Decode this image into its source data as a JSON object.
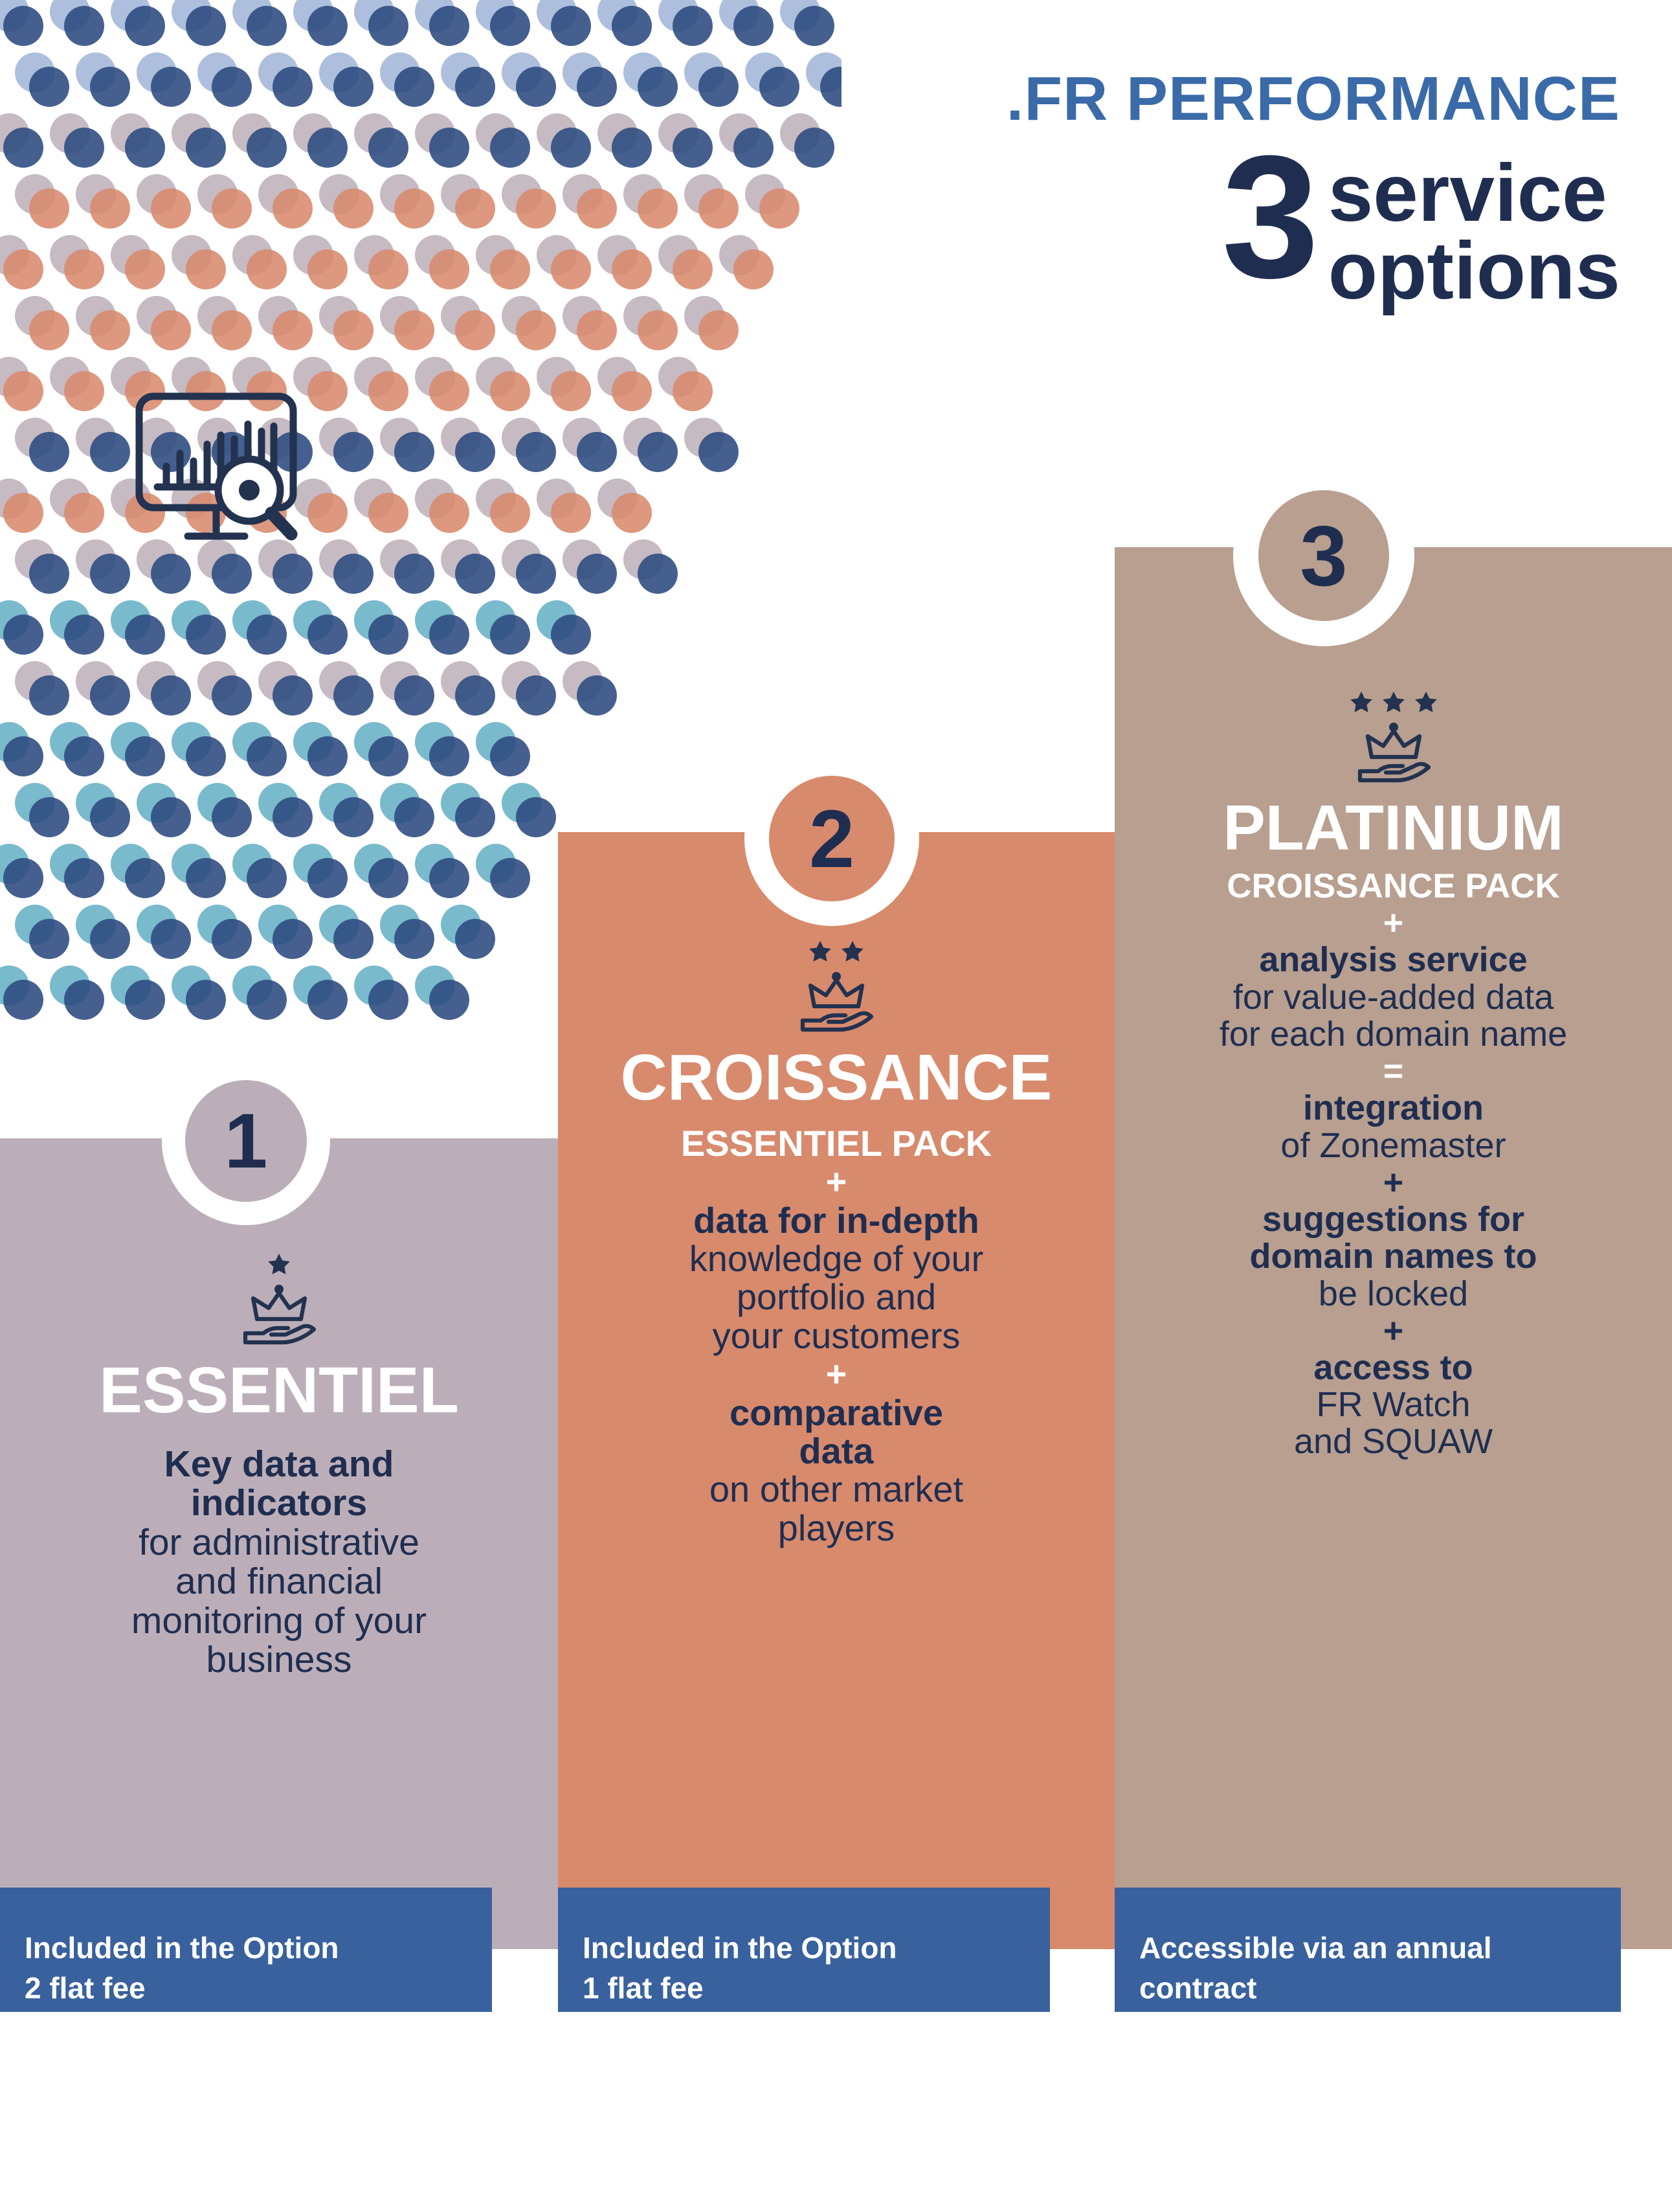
{
  "header": {
    "brand": ".FR PERFORMANCE",
    "count": "3",
    "word_1": "service",
    "word_2": "options"
  },
  "colors": {
    "brand_blue": "#3a6aa8",
    "navy": "#1f2e50",
    "mauve": "#bcaeb8",
    "orange": "#d88a6d",
    "tan": "#b89f90",
    "footer_blue": "#38619e",
    "white": "#ffffff",
    "dot_light_blue": "#9fb4d6",
    "dot_dark_blue": "#2b4a80",
    "dot_mid_blue": "#3a6aa8",
    "dot_teal": "#63aec4",
    "dot_mauve": "#bcaeb8",
    "dot_orange": "#d88a6d"
  },
  "columns": [
    {
      "number": "1",
      "name": "ESSENTIEL",
      "stars": 1,
      "body_lines": [
        {
          "text": "Key data and",
          "bold": true
        },
        {
          "text": "indicators",
          "bold": true
        },
        {
          "text": "for administrative",
          "bold": false
        },
        {
          "text": "and financial",
          "bold": false
        },
        {
          "text": "monitoring of your",
          "bold": false
        },
        {
          "text": "business",
          "bold": false
        }
      ],
      "footer": "Included in the Option 2 flat fee"
    },
    {
      "number": "2",
      "name": "CROISSANCE",
      "stars": 2,
      "body_lines": [
        {
          "text": "ESSENTIEL PACK",
          "style": "white-bold"
        },
        {
          "text": "+",
          "style": "white-symbol"
        },
        {
          "text": "data for in-depth",
          "style": "lead-bold"
        },
        {
          "text": "knowledge of your",
          "style": "normal"
        },
        {
          "text": "portfolio and",
          "style": "normal"
        },
        {
          "text": "your customers",
          "style": "normal"
        },
        {
          "text": "+",
          "style": "white-symbol"
        },
        {
          "text": "comparative",
          "style": "bold"
        },
        {
          "text": "data",
          "style": "bold"
        },
        {
          "text": "on other market",
          "style": "normal"
        },
        {
          "text": "players",
          "style": "normal"
        }
      ],
      "footer": "Included in the Option 1 flat fee"
    },
    {
      "number": "3",
      "name": "PLATINIUM",
      "stars": 3,
      "body_lines": [
        {
          "text": "CROISSANCE PACK",
          "style": "white-bold"
        },
        {
          "text": "+",
          "style": "white-symbol"
        },
        {
          "text": "analysis service",
          "style": "bold"
        },
        {
          "text": "for value-added data",
          "style": "normal"
        },
        {
          "text": "for each domain name",
          "style": "normal"
        },
        {
          "text": "=",
          "style": "white-symbol"
        },
        {
          "text": "integration",
          "style": "bold"
        },
        {
          "text": "of Zonemaster",
          "style": "normal"
        },
        {
          "text": "+",
          "style": "navy-symbol"
        },
        {
          "text": "suggestions for",
          "style": "bold"
        },
        {
          "text": "domain names to",
          "style": "lead-bold"
        },
        {
          "text": "be locked",
          "style": "normal"
        },
        {
          "text": "+",
          "style": "navy-symbol"
        },
        {
          "text": "access to",
          "style": "bold"
        },
        {
          "text": "FR Watch",
          "style": "normal"
        },
        {
          "text": "and SQUAW",
          "style": "normal"
        }
      ],
      "footer": "Accessible via an annual contract"
    }
  ],
  "footers": [
    {
      "line1": "Included in the Option",
      "line2": "2 flat fee"
    },
    {
      "line1": "Included in the Option",
      "line2": "1 flat fee"
    },
    {
      "line1": "Accessible via an annual",
      "line2": "contract"
    }
  ],
  "icons": {
    "chart_monitor": "chart-monitor-magnifier-icon",
    "crown": "crown-in-hand-icon",
    "star": "star-icon"
  }
}
